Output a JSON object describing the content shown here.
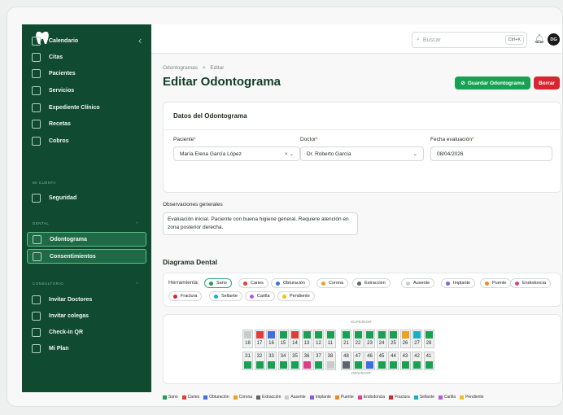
{
  "sidebar": {
    "items_top": [
      {
        "label": "Calendario"
      },
      {
        "label": "Citas"
      },
      {
        "label": "Pacientes"
      },
      {
        "label": "Servicios"
      },
      {
        "label": "Expediente Clínico"
      },
      {
        "label": "Recetas"
      },
      {
        "label": "Cobros"
      }
    ],
    "section_cuenta": "MI CUENTA",
    "items_cuenta": [
      {
        "label": "Seguridad"
      }
    ],
    "section_dental": "DENTAL",
    "items_dental": [
      {
        "label": "Odontograma"
      },
      {
        "label": "Consentimientos"
      }
    ],
    "section_consultorio": "CONSULTORIO",
    "items_consultorio": [
      {
        "label": "Invitar Doctores"
      },
      {
        "label": "Invitar colegas"
      },
      {
        "label": "Check-in QR"
      },
      {
        "label": "Mi Plan"
      }
    ]
  },
  "topbar": {
    "search_placeholder": "Buscar",
    "shortcut": "Ctrl+K",
    "avatar": "DG"
  },
  "breadcrumb": {
    "parent": "Odontogramas",
    "sep": ">",
    "current": "Editar"
  },
  "page_title": "Editar Odontograma",
  "actions": {
    "save": "Guardar Odontograma",
    "delete": "Borrar"
  },
  "form": {
    "section_title": "Datos del Odontograma",
    "paciente_label": "Paciente",
    "paciente_value": "María Elena García López",
    "doctor_label": "Doctor",
    "doctor_value": "Dr. Roberto García",
    "fecha_label": "Fecha evaluación",
    "fecha_value": "08/04/2026",
    "obs_label": "Observaciones generales",
    "obs_value": "Evaluación inicial. Paciente con buena higiene general. Requiere atención en zona posterior derecha."
  },
  "diagram": {
    "title": "Diagrama Dental",
    "tool_label": "Herramienta:",
    "tools": [
      {
        "label": "Sano",
        "color": "#18a053"
      },
      {
        "label": "Caries",
        "color": "#e03c3c"
      },
      {
        "label": "Obturación",
        "color": "#3d6fe0"
      },
      {
        "label": "Corona",
        "color": "#f0a020"
      },
      {
        "label": "Extracción",
        "color": "#5c6470"
      },
      {
        "label": "Ausente",
        "color": "#c8ccca"
      },
      {
        "label": "Implante",
        "color": "#8a5ce0"
      },
      {
        "label": "Puente",
        "color": "#f08a20"
      },
      {
        "label": "Endodoncia",
        "color": "#e03c8a"
      },
      {
        "label": "Fractura",
        "color": "#d9252f"
      },
      {
        "label": "Sellante",
        "color": "#17b0c9"
      },
      {
        "label": "Carilla",
        "color": "#b05ce0"
      },
      {
        "label": "Pendiente",
        "color": "#f0c020"
      }
    ],
    "upper_label": "SUPERIOR",
    "lower_label": "INFERIOR",
    "upper": [
      {
        "num": "18",
        "status": "Ausente"
      },
      {
        "num": "17",
        "status": "Caries"
      },
      {
        "num": "16",
        "status": "Obturación"
      },
      {
        "num": "15",
        "status": "Sano"
      },
      {
        "num": "14",
        "status": "Caries"
      },
      {
        "num": "13",
        "status": "Sano"
      },
      {
        "num": "12",
        "status": "Sano"
      },
      {
        "num": "11",
        "status": "Sano"
      },
      {
        "num": "21",
        "status": "Sano"
      },
      {
        "num": "22",
        "status": "Sano"
      },
      {
        "num": "23",
        "status": "Sano"
      },
      {
        "num": "24",
        "status": "Sano"
      },
      {
        "num": "25",
        "status": "Sano"
      },
      {
        "num": "26",
        "status": "Corona"
      },
      {
        "num": "27",
        "status": "Sellante"
      },
      {
        "num": "28",
        "status": "Sano"
      }
    ],
    "lower": [
      {
        "num": "31",
        "status": "Sano"
      },
      {
        "num": "32",
        "status": "Sano"
      },
      {
        "num": "33",
        "status": "Sano"
      },
      {
        "num": "34",
        "status": "Sano"
      },
      {
        "num": "35",
        "status": "Sano"
      },
      {
        "num": "36",
        "status": "Endodoncia"
      },
      {
        "num": "37",
        "status": "Sano"
      },
      {
        "num": "38",
        "status": "Ausente"
      },
      {
        "num": "48",
        "status": "Extracción"
      },
      {
        "num": "47",
        "status": "Sano"
      },
      {
        "num": "46",
        "status": "Obturación"
      },
      {
        "num": "45",
        "status": "Sano"
      },
      {
        "num": "44",
        "status": "Sano"
      },
      {
        "num": "43",
        "status": "Sano"
      },
      {
        "num": "42",
        "status": "Sano"
      },
      {
        "num": "41",
        "status": "Sano"
      }
    ]
  }
}
